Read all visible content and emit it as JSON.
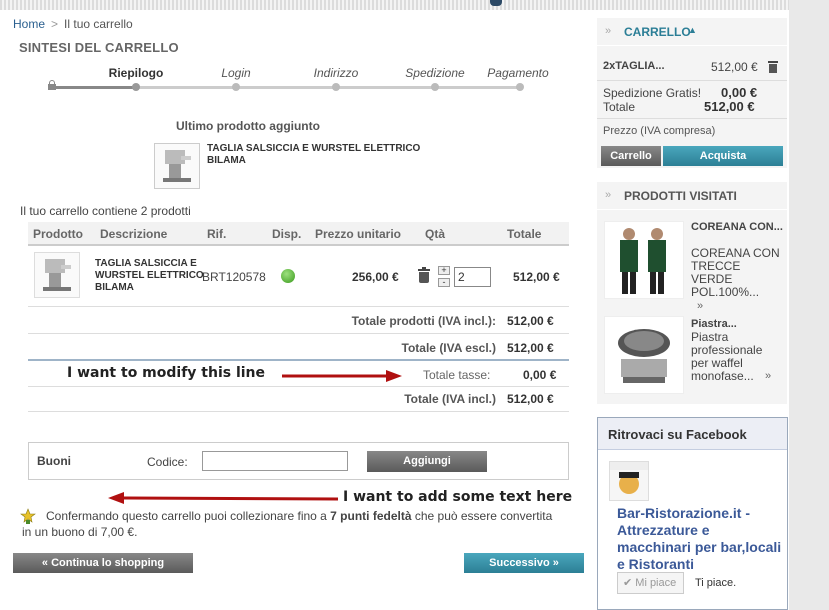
{
  "breadcrumb": {
    "home": "Home",
    "separator": ">",
    "current": "Il tuo carrello"
  },
  "page_title": "SINTESI DEL CARRELLO",
  "steps": [
    "Riepilogo",
    "Login",
    "Indirizzo",
    "Spedizione",
    "Pagamento"
  ],
  "last_added": {
    "title": "Ultimo prodotto aggiunto",
    "name": "TAGLIA SALSICCIA E WURSTEL ELETTRICO BILAMA"
  },
  "cart_count": "Il tuo carrello contiene 2 prodotti",
  "table": {
    "headers": [
      "Prodotto",
      "Descrizione",
      "Rif.",
      "Disp.",
      "Prezzo unitario",
      "Qtà",
      "Totale"
    ],
    "row": {
      "description": "TAGLIA SALSICCIA E WURSTEL ELETTRICO BILAMA",
      "ref": "BRT120578",
      "unit_price": "256,00 €",
      "qty": "2",
      "plus": "+",
      "minus": "-",
      "total": "512,00 €"
    }
  },
  "totals": [
    {
      "label": "Totale prodotti (IVA incl.):",
      "value": "512,00 €"
    },
    {
      "label": "Totale (IVA escl.)",
      "value": "512,00 €"
    },
    {
      "label": "Totale tasse:",
      "value": "0,00 €"
    },
    {
      "label": "Totale (IVA incl.)",
      "value": "512,00 €"
    }
  ],
  "annotations": {
    "modify": "I want to modify this line",
    "add_text": "I want to add some text here"
  },
  "vouchers": {
    "title": "Buoni",
    "code_label": "Codice:",
    "add_button": "Aggiungi",
    "code_value": ""
  },
  "loyalty": {
    "pre": "Confermando questo carrello puoi collezionare fino a ",
    "points": "7 punti fedeltà",
    "post": " che può essere convertita in un buono di 7,00 €."
  },
  "buttons": {
    "continue": "« Continua lo shopping",
    "next": "Successivo »"
  },
  "sidebar": {
    "cart": {
      "title": "CARRELLO",
      "item_name": "2xTAGLIA...",
      "item_price": "512,00 €",
      "shipping_label": "Spedizione Gratis!",
      "shipping_value": "0,00 €",
      "total_label": "Totale",
      "total_value": "512,00 €",
      "tax_note": "Prezzo (IVA compresa)",
      "cart_button": "Carrello",
      "checkout_button": "Acquista"
    },
    "visited": {
      "title": "PRODOTTI VISITATI",
      "items": [
        {
          "name": "COREANA CON...",
          "desc": "COREANA CON TRECCE VERDE POL.100%...",
          "more": "»"
        },
        {
          "name": "Piastra...",
          "desc": "Piastra professionale per waffel monofase...",
          "more": "»"
        }
      ]
    },
    "facebook": {
      "title": "Ritrovaci su Facebook",
      "page_name": "Bar-Ristorazione.it - Attrezzature e macchinari per bar,locali e Ristoranti",
      "like_button": "Mi piace",
      "like_text": "Ti piace."
    }
  },
  "colors": {
    "accent_teal": "#2c7f95",
    "annotation_arrow": "#b01010",
    "link": "#2a5f8f"
  }
}
